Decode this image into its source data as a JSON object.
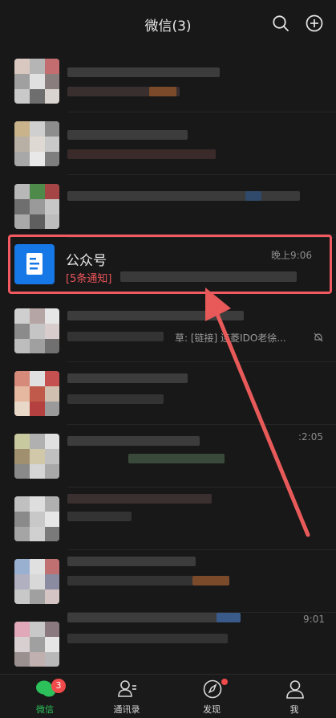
{
  "header": {
    "title": "微信(3)"
  },
  "pinned_account": {
    "name": "公众号",
    "time": "晚上9:06",
    "notice": "[5条通知]"
  },
  "rows": [
    {
      "time": "",
      "snippet": ""
    },
    {
      "time": "",
      "snippet": ""
    },
    {
      "time": "",
      "snippet": ""
    },
    {
      "time": "",
      "snippet": "草: [链接] 连菱IDO老徐..."
    },
    {
      "time": "",
      "snippet": ""
    },
    {
      "time": ":2:05",
      "snippet": ""
    },
    {
      "time": "",
      "snippet": ""
    },
    {
      "time": "",
      "snippet": ""
    },
    {
      "time": "9:01",
      "snippet": ""
    }
  ],
  "tabbar": {
    "tabs": [
      {
        "label": "微信",
        "badge": "3",
        "active": true
      },
      {
        "label": "通讯录"
      },
      {
        "label": "发现",
        "dot": true
      },
      {
        "label": "我"
      }
    ]
  },
  "colors": {
    "accent_green": "#2dc15b",
    "highlight_red": "#f05a60",
    "badge_red": "#f04a4a",
    "account_blue": "#1677e6"
  }
}
